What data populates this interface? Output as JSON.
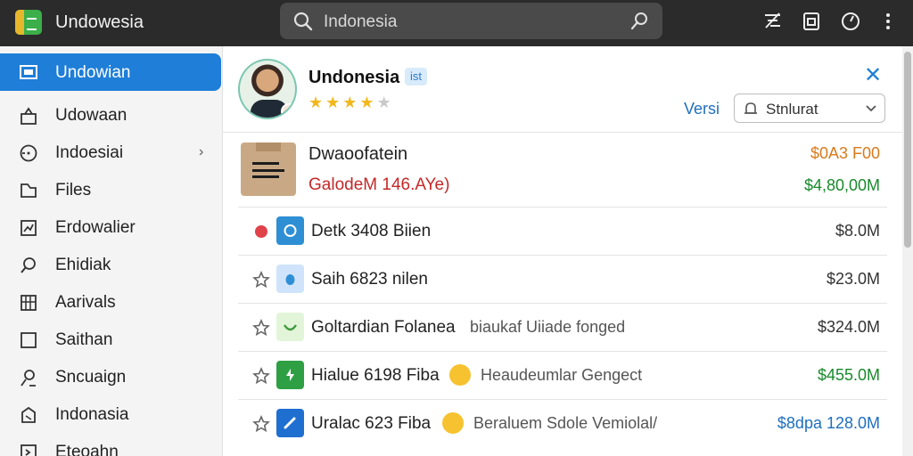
{
  "titlebar": {
    "app_title": "Undowesia",
    "search_value": "Indonesia"
  },
  "sidebar": {
    "items": [
      {
        "label": "Undowian",
        "icon": "monitor-icon",
        "active": true
      },
      {
        "label": "Udowaan",
        "icon": "lock-icon"
      },
      {
        "label": "Indoesiai",
        "icon": "clock-icon",
        "chevron": "›"
      },
      {
        "label": "Files",
        "icon": "folder-icon"
      },
      {
        "label": "Erdowalier",
        "icon": "chart-icon"
      },
      {
        "label": "Ehidiak",
        "icon": "search-icon"
      },
      {
        "label": "Aarivals",
        "icon": "grid-icon"
      },
      {
        "label": "Saithan",
        "icon": "square-icon"
      },
      {
        "label": "Sncuaign",
        "icon": "user-icon"
      },
      {
        "label": "Indonasia",
        "icon": "tag-icon"
      },
      {
        "label": "Eteoahn",
        "icon": "arrow-icon"
      }
    ]
  },
  "profile": {
    "name": "Undonesia",
    "tag": "ist",
    "rating": 4,
    "rating_max": 5,
    "versi_label": "Versi",
    "dropdown_label": "Stnlurat",
    "close": "✕"
  },
  "featured": {
    "title": "Dwaoofatein",
    "subtitle": "GalodeM 146.AYe)",
    "value_top": "$0A3 F00",
    "value_bottom": "$4,80,00M",
    "colors": {
      "subtitle": "#c62828",
      "value_top": "#d97a1c",
      "value_bottom": "#188a2b"
    }
  },
  "rows": [
    {
      "label": "Detk 3408 Biien",
      "sub": "",
      "value": "$8.0M",
      "lead": "red-dot",
      "icon_color": "#2f8fd4",
      "value_color": "#333333"
    },
    {
      "label": "Saih 6823 nilen",
      "sub": "",
      "value": "$23.0M",
      "lead": "star-outline",
      "icon_color": "#cfe4fb",
      "value_color": "#333333"
    },
    {
      "label": "Goltardian Folanea",
      "sub": "biaukaf Uiiade fonged",
      "value": "$324.0M",
      "lead": "star-outline",
      "icon_color": "#e2f5d9",
      "value_color": "#333333"
    },
    {
      "label": "Hialue 6198 Fiba",
      "sub": "Heaudeumlar Gengect",
      "value": "$455.0M",
      "lead": "star-outline",
      "icon_color": "#2ea043",
      "value_color": "#188a2b",
      "emoji": true
    },
    {
      "label": "Uralac 623 Fiba",
      "sub": "Beraluem Sdole Vemiolal/",
      "value": "$8dpa 128.0M",
      "lead": "star-outline",
      "icon_color": "#1f6fd1",
      "value_color": "#1e6fbf",
      "emoji": true
    }
  ]
}
